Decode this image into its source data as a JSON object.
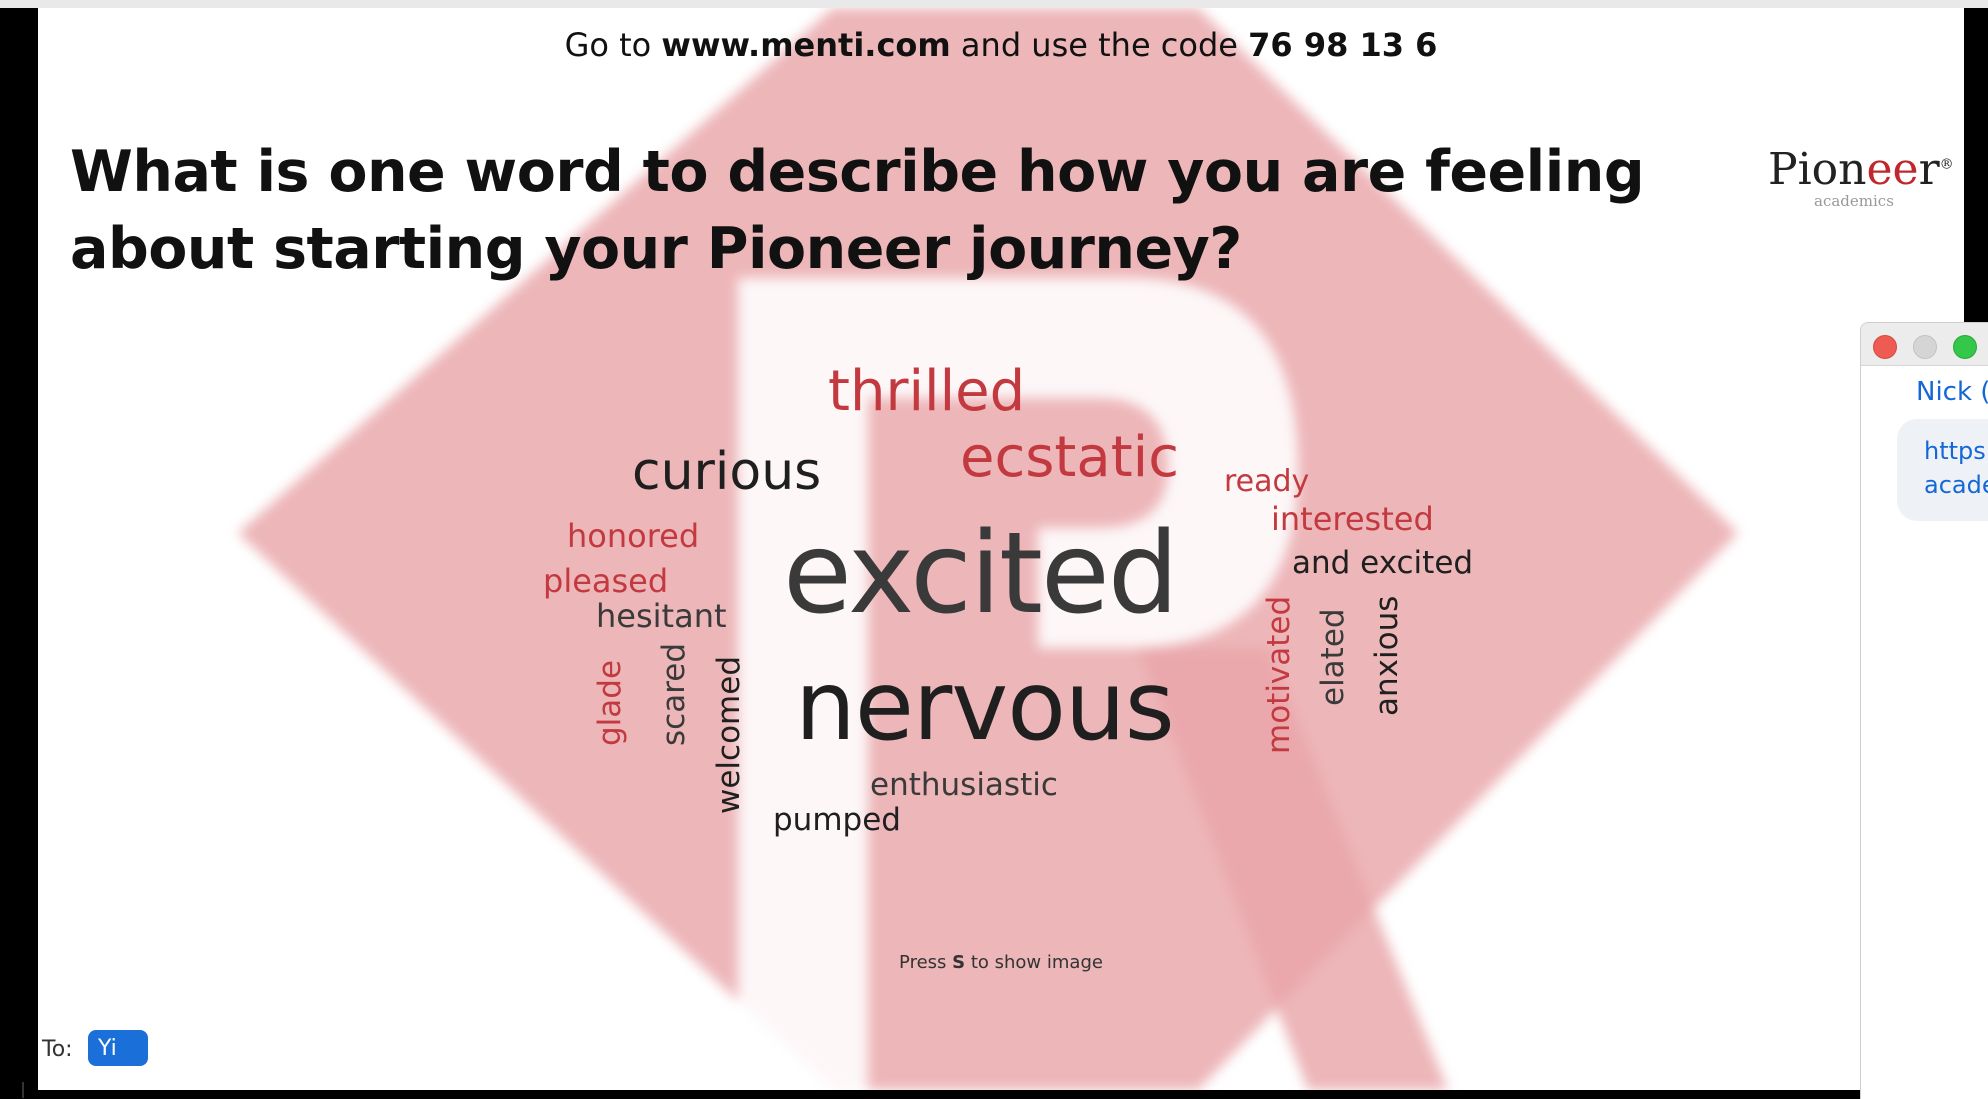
{
  "slide": {
    "instruction_prefix": "Go to",
    "instruction_url": "www.menti.com",
    "instruction_middle": "and use the code",
    "instruction_code": "76 98 13 6",
    "question": "What is one word to describe how you are feeling about starting your Pioneer journey?",
    "brand_name_start": "Pion",
    "brand_name_ee": "ee",
    "brand_name_end": "r",
    "brand_tm": "®",
    "brand_sub": "academics",
    "press_prefix": "Press",
    "press_key": "S",
    "press_suffix": "to show image"
  },
  "word_cloud": {
    "words": [
      "thrilled",
      "ecstatic",
      "curious",
      "ready",
      "interested",
      "honored",
      "and excited",
      "pleased",
      "excited",
      "hesitant",
      "nervous",
      "glade",
      "scared",
      "welcomed",
      "motivated",
      "elated",
      "anxious",
      "enthusiastic",
      "pumped"
    ],
    "colors": {
      "red": "#c23a40",
      "dark": "#1f1f1f"
    }
  },
  "chat": {
    "sender": "Nick (",
    "message_line1": "https",
    "message_line2": "acade",
    "to_label": "To:",
    "to_value": "Yi"
  }
}
